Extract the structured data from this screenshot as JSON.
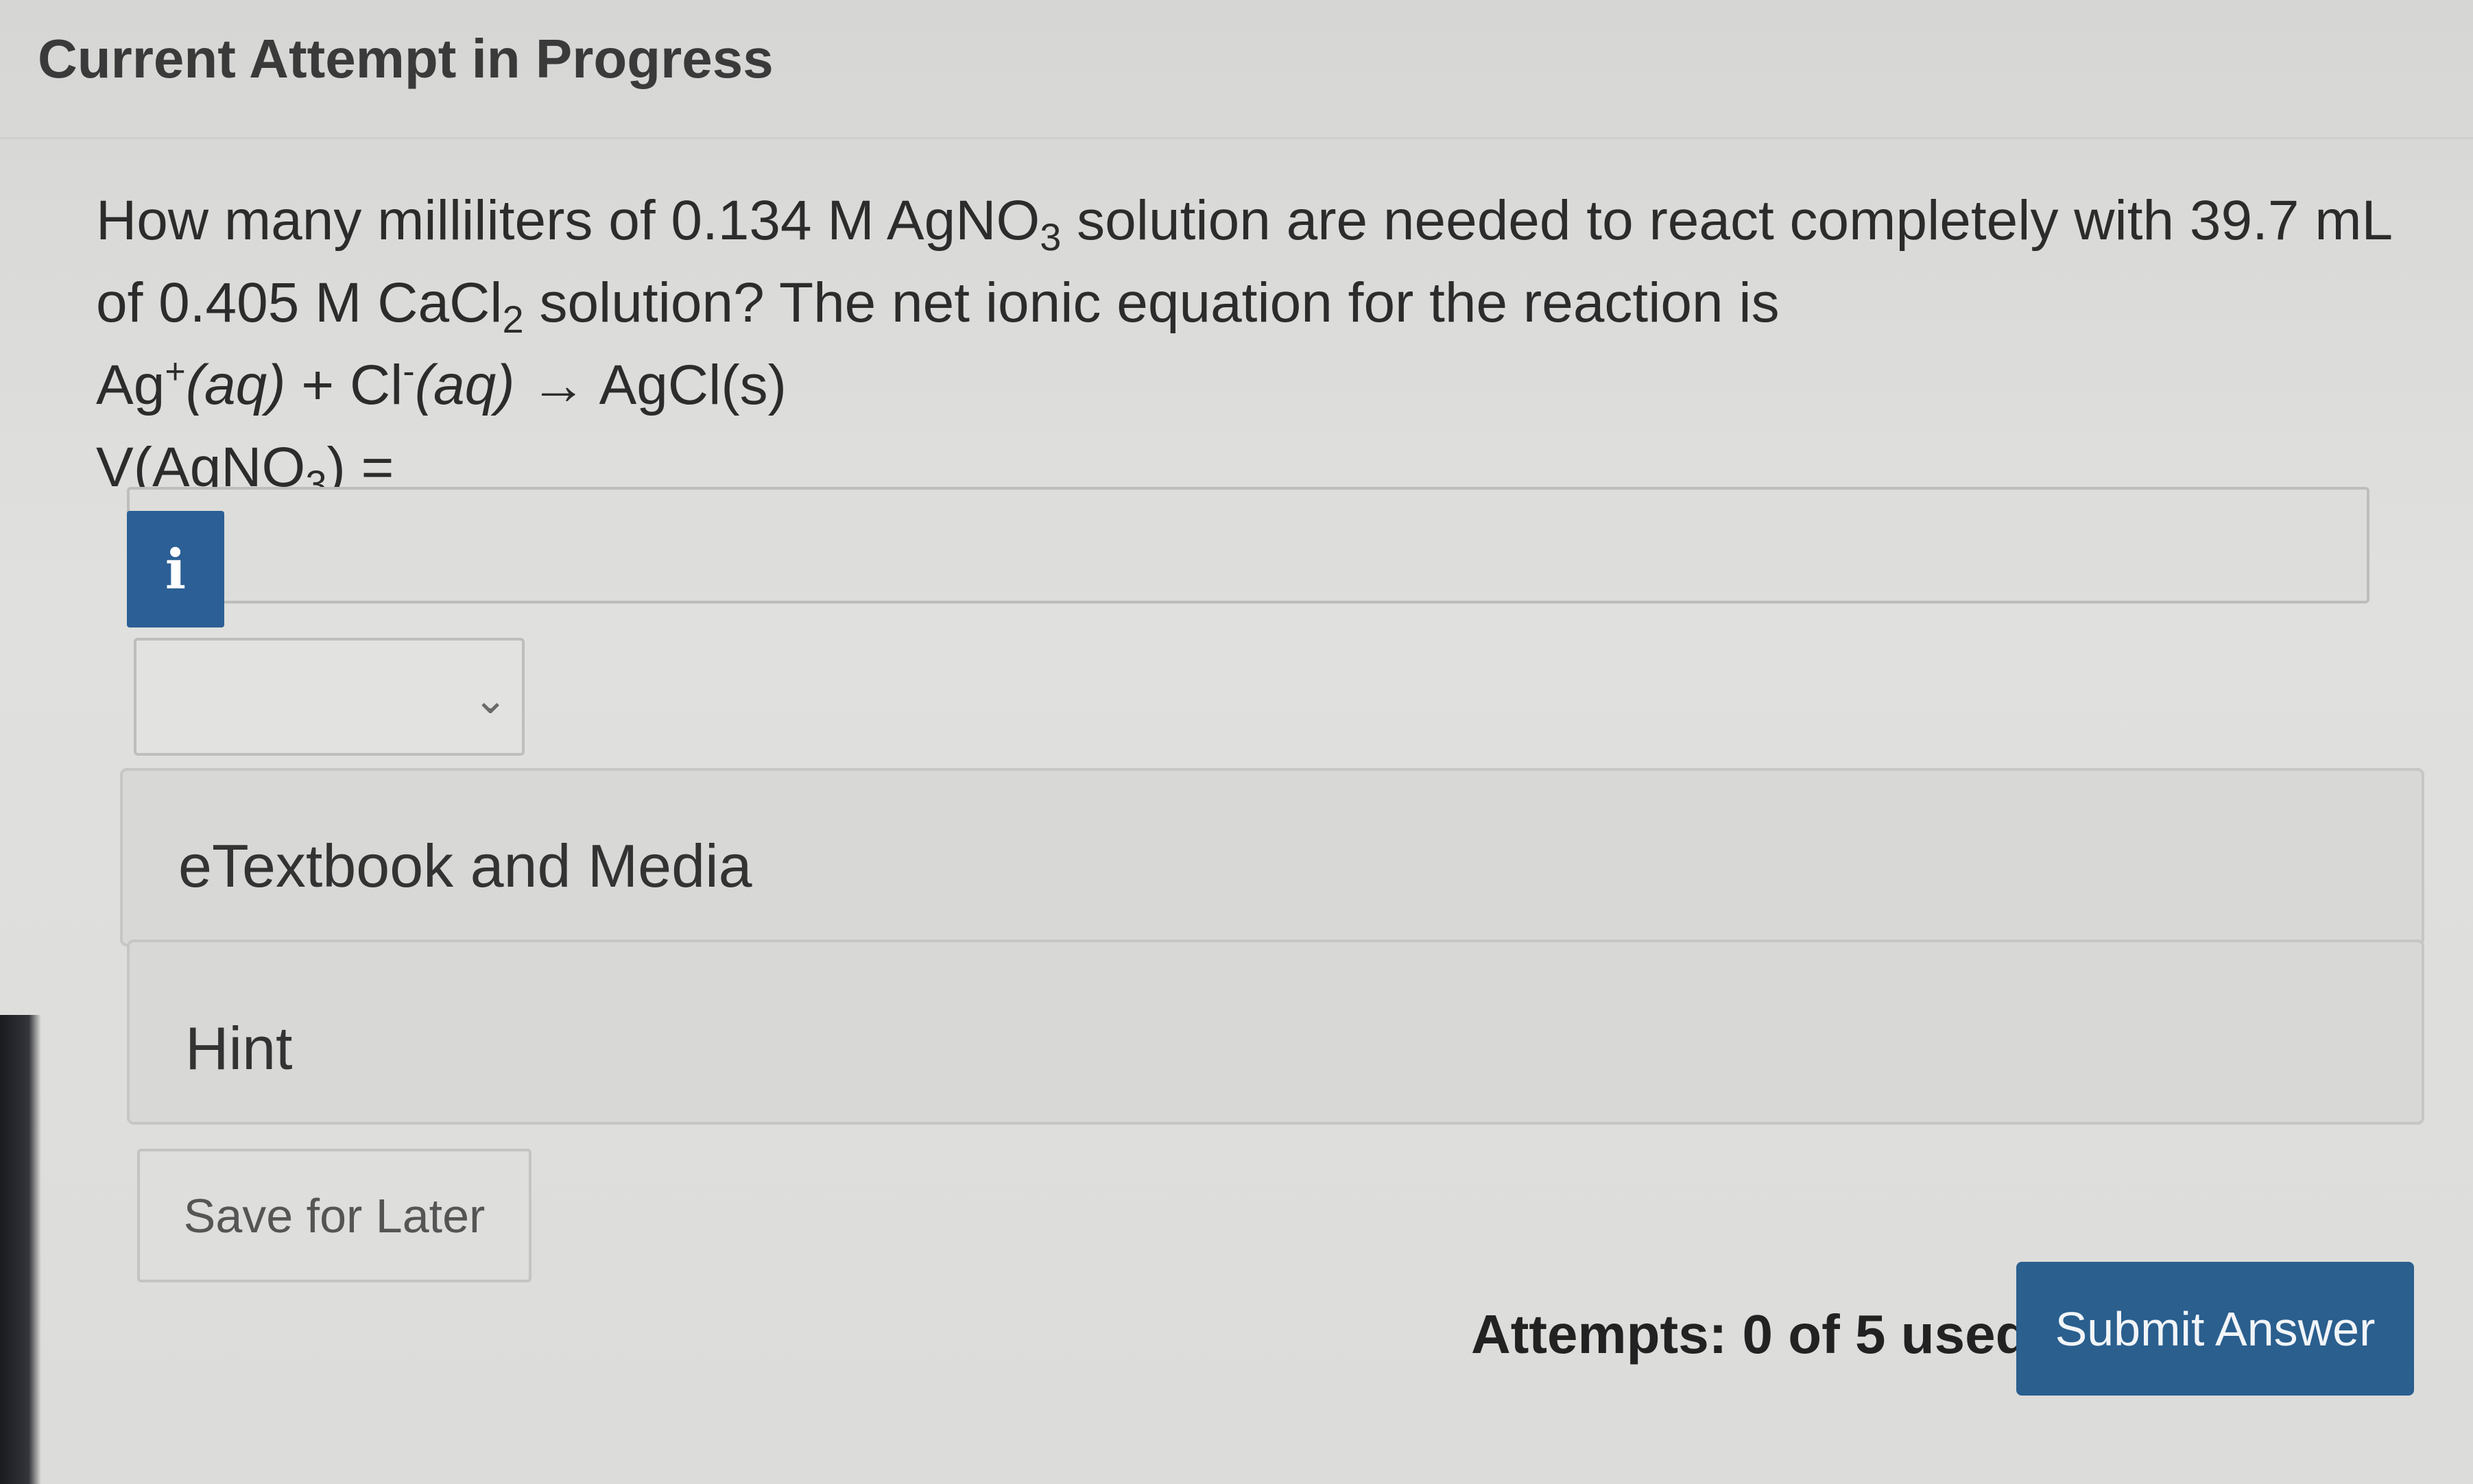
{
  "header": {
    "title": "Current Attempt in Progress"
  },
  "question": {
    "line1_a": "How many milliliters of 0.134 M AgNO",
    "line1_sub": "3",
    "line1_b": " solution are needed to react completely with 39.7 mL",
    "line2_a": "of 0.405 M CaCl",
    "line2_sub": "2",
    "line2_b": " solution? The net ionic equation for the reaction is",
    "eq_ag": "Ag",
    "eq_ag_charge": "+",
    "eq_aq1": "(aq)",
    "eq_plus": " + Cl",
    "eq_cl_charge": "-",
    "eq_aq2": "(aq)",
    "eq_arrow": " → AgCl(s)",
    "v_label_a": "V(AgNO",
    "v_label_sub": "3",
    "v_label_b": ") ="
  },
  "answer": {
    "info_icon": "i",
    "value": "",
    "unit_selected": ""
  },
  "panels": {
    "media_label": "eTextbook and Media",
    "hint_label": "Hint"
  },
  "footer": {
    "save_label": "Save for Later",
    "attempts_text": "Attempts: 0 of 5 used",
    "submit_label": "Submit Answer"
  },
  "colors": {
    "primary": "#2a5f8e",
    "info": "#2b5f95"
  }
}
